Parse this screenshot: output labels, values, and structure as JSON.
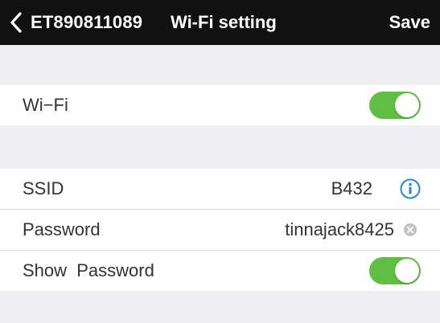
{
  "topbar": {
    "device_id": "ET890811089",
    "title": "Wi-Fi setting",
    "save_label": "Save",
    "back_icon": "chevron-left-icon"
  },
  "rows": {
    "wifi": {
      "label": "Wi−Fi",
      "enabled": true
    },
    "ssid": {
      "label": "SSID",
      "value": "B432",
      "icon": "info-icon"
    },
    "password": {
      "label": "Password",
      "value": "tinnajack8425",
      "icon": "clear-icon"
    },
    "show_password": {
      "label": "Show  Password",
      "enabled": true
    }
  },
  "colors": {
    "header_bg": "#111111",
    "toggle_on": "#5fbf41",
    "info_blue": "#1e88e5",
    "page_bg": "#efeff4"
  }
}
